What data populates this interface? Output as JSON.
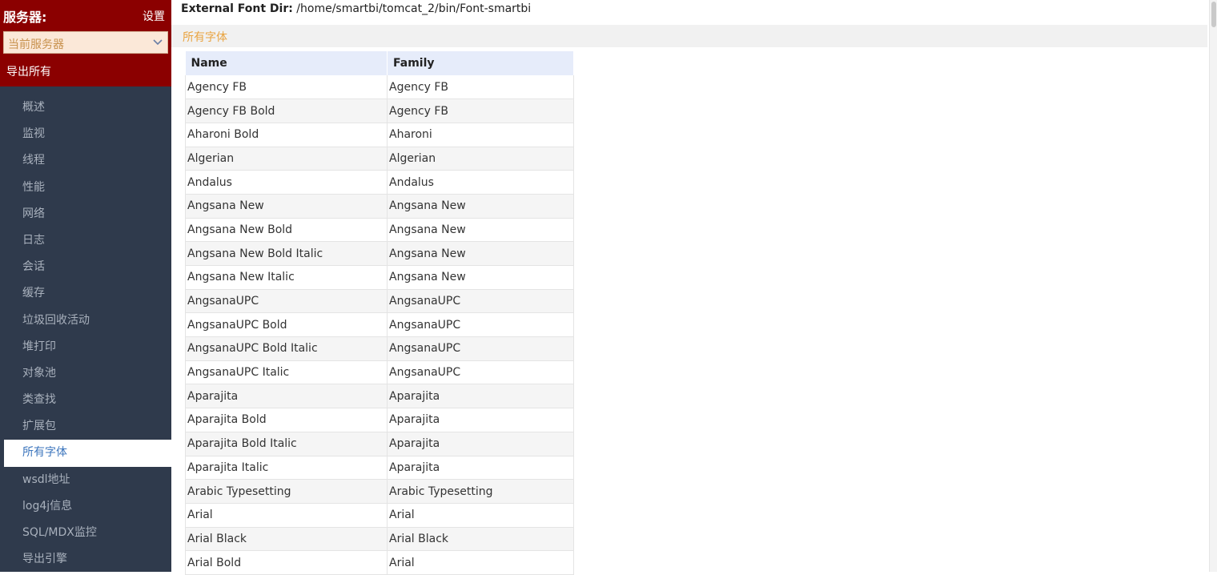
{
  "sidebar": {
    "server_title": "服务器:",
    "settings_label": "设置",
    "server_select": {
      "value": "当前服务器"
    },
    "export_all_label": "导出所有",
    "nav_items": [
      {
        "label": "概述"
      },
      {
        "label": "监视"
      },
      {
        "label": "线程"
      },
      {
        "label": "性能"
      },
      {
        "label": "网络"
      },
      {
        "label": "日志"
      },
      {
        "label": "会话"
      },
      {
        "label": "缓存"
      },
      {
        "label": "垃圾回收活动"
      },
      {
        "label": "堆打印"
      },
      {
        "label": "对象池"
      },
      {
        "label": "类查找"
      },
      {
        "label": "扩展包"
      },
      {
        "label": "所有字体",
        "active": true
      },
      {
        "label": "wsdl地址"
      },
      {
        "label": "log4j信息"
      },
      {
        "label": "SQL/MDX监控"
      },
      {
        "label": "导出引擎"
      }
    ]
  },
  "main": {
    "font_dir_label": "External Font Dir:",
    "font_dir_value": "/home/smartbi/tomcat_2/bin/Font-smartbi",
    "section_title": "所有字体",
    "table": {
      "headers": [
        "Name",
        "Family"
      ],
      "rows": [
        [
          "Agency FB",
          "Agency FB"
        ],
        [
          "Agency FB Bold",
          "Agency FB"
        ],
        [
          "Aharoni Bold",
          "Aharoni"
        ],
        [
          "Algerian",
          "Algerian"
        ],
        [
          "Andalus",
          "Andalus"
        ],
        [
          "Angsana New",
          "Angsana New"
        ],
        [
          "Angsana New Bold",
          "Angsana New"
        ],
        [
          "Angsana New Bold Italic",
          "Angsana New"
        ],
        [
          "Angsana New Italic",
          "Angsana New"
        ],
        [
          "AngsanaUPC",
          "AngsanaUPC"
        ],
        [
          "AngsanaUPC Bold",
          "AngsanaUPC"
        ],
        [
          "AngsanaUPC Bold Italic",
          "AngsanaUPC"
        ],
        [
          "AngsanaUPC Italic",
          "AngsanaUPC"
        ],
        [
          "Aparajita",
          "Aparajita"
        ],
        [
          "Aparajita Bold",
          "Aparajita"
        ],
        [
          "Aparajita Bold Italic",
          "Aparajita"
        ],
        [
          "Aparajita Italic",
          "Aparajita"
        ],
        [
          "Arabic Typesetting",
          "Arabic Typesetting"
        ],
        [
          "Arial",
          "Arial"
        ],
        [
          "Arial Black",
          "Arial Black"
        ],
        [
          "Arial Bold",
          "Arial"
        ]
      ]
    }
  },
  "colors": {
    "header_red": "#8b0000",
    "sidebar_bg": "#2f3a4c",
    "active_text": "#3d76bd",
    "section_title": "#e9a441",
    "table_header_bg": "#e6ecfa"
  },
  "icons": {
    "select": "chevron-down-icon"
  }
}
